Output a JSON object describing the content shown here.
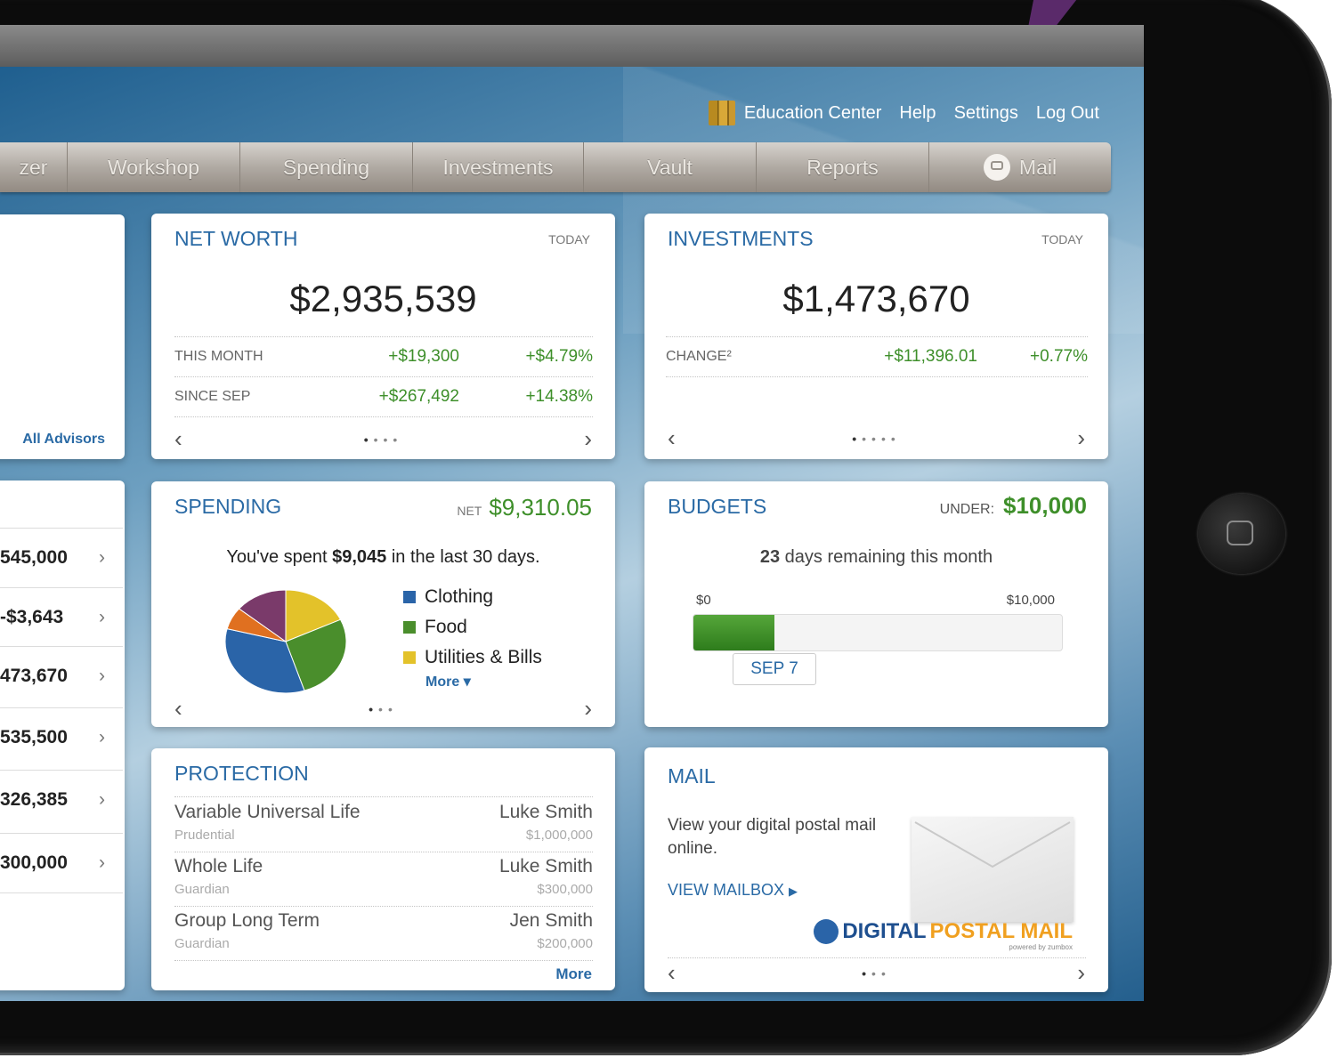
{
  "top_links": {
    "education_center": "Education Center",
    "help": "Help",
    "settings": "Settings",
    "logout": "Log Out"
  },
  "nav": [
    "zer",
    "Workshop",
    "Spending",
    "Investments",
    "Vault",
    "Reports",
    "Mail"
  ],
  "advisors_card": {
    "link": "All Advisors"
  },
  "left_list": [
    {
      "value": "545,000"
    },
    {
      "value": "-$3,643"
    },
    {
      "value": "473,670"
    },
    {
      "value": "535,500"
    },
    {
      "value": "326,385"
    },
    {
      "value": "300,000"
    }
  ],
  "net_worth": {
    "title": "NET WORTH",
    "period": "TODAY",
    "value": "$2,935,539",
    "rows": [
      {
        "label": "THIS MONTH",
        "amount": "+$19,300",
        "pct": "+$4.79%"
      },
      {
        "label": "SINCE SEP",
        "amount": "+$267,492",
        "pct": "+14.38%"
      }
    ]
  },
  "investments": {
    "title": "INVESTMENTS",
    "period": "TODAY",
    "value": "$1,473,670",
    "change_label": "CHANGE²",
    "change_amount": "+$11,396.01",
    "change_pct": "+0.77%"
  },
  "spending": {
    "title": "SPENDING",
    "net_label": "NET",
    "net_value": "$9,310.05",
    "summary_pre": "You've spent ",
    "summary_amount": "$9,045",
    "summary_post": " in the last 30 days.",
    "legend": [
      {
        "name": "Clothing",
        "color": "#2a64a8"
      },
      {
        "name": "Food",
        "color": "#4a8e2c"
      },
      {
        "name": "Utilities & Bills",
        "color": "#e3c22a"
      }
    ],
    "more": "More",
    "pie": [
      {
        "name": "Utilities & Bills",
        "fraction": 0.18,
        "color": "#e3c22a"
      },
      {
        "name": "Food",
        "fraction": 0.27,
        "color": "#4a8e2c"
      },
      {
        "name": "Clothing",
        "fraction": 0.34,
        "color": "#2a64a8"
      },
      {
        "name": "",
        "fraction": 0.07,
        "color": "#e07020"
      },
      {
        "name": "",
        "fraction": 0.14,
        "color": "#7a3a6a"
      }
    ]
  },
  "budgets": {
    "title": "BUDGETS",
    "under_label": "UNDER:",
    "under_value": "$10,000",
    "days_num": "23",
    "days_text": " days remaining this month",
    "min": "$0",
    "max": "$10,000",
    "progress": 0.22,
    "marker": "SEP 7"
  },
  "protection": {
    "title": "PROTECTION",
    "rows": [
      {
        "name": "Variable Universal Life",
        "carrier": "Prudential",
        "owner": "Luke Smith",
        "amount": "$1,000,000"
      },
      {
        "name": "Whole Life",
        "carrier": "Guardian",
        "owner": "Luke Smith",
        "amount": "$300,000"
      },
      {
        "name": "Group Long Term",
        "carrier": "Guardian",
        "owner": "Jen Smith",
        "amount": "$200,000"
      }
    ],
    "more": "More"
  },
  "mail": {
    "title": "MAIL",
    "text": "View your digital postal mail online.",
    "link": "VIEW MAILBOX",
    "brand_a": "DIGITAL",
    "brand_b": "POSTAL MAIL",
    "powered": "powered by zumbox"
  },
  "colors": {
    "accent_blue": "#2a6aa5",
    "positive_green": "#3e8f2a"
  }
}
